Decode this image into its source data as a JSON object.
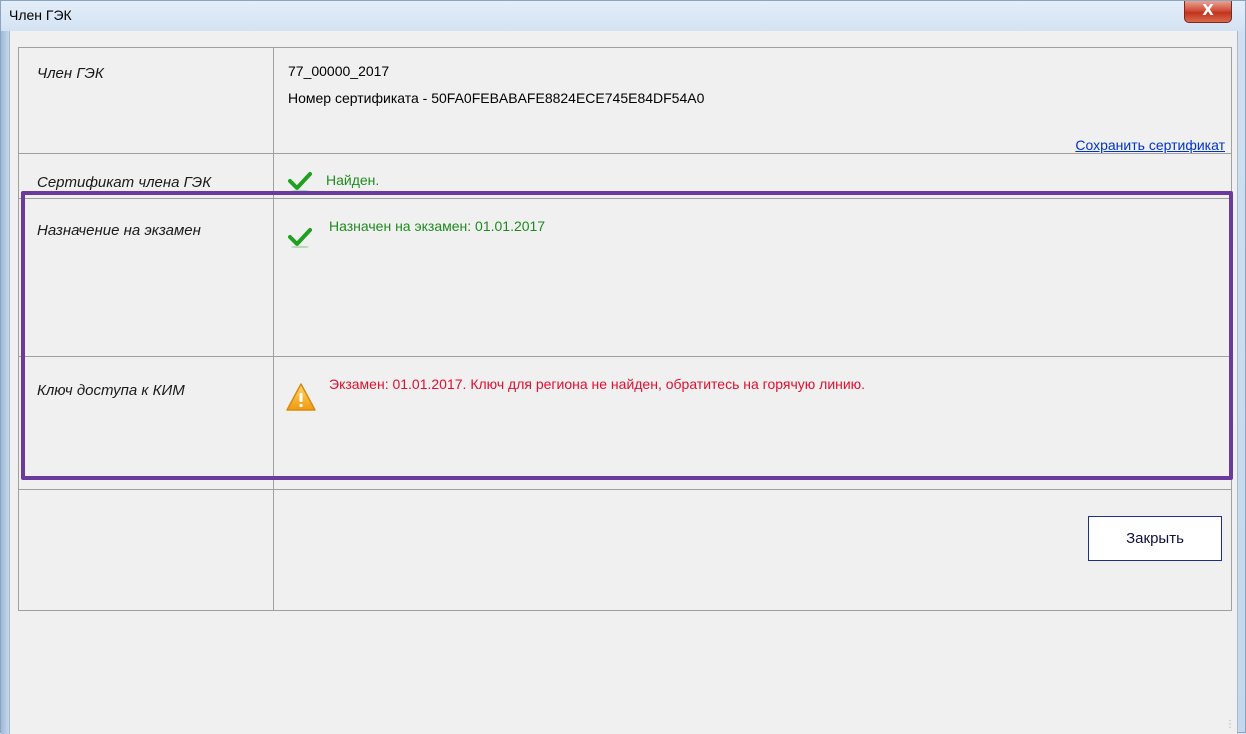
{
  "window": {
    "title": "Член ГЭК",
    "close_glyph": "X"
  },
  "rows": {
    "member": {
      "label": "Член ГЭК",
      "value_line1": "77_00000_2017",
      "value_line2": "Номер сертификата - 50FA0FEBABAFE8824ECE745E84DF54A0",
      "save_link": "Сохранить сертификат"
    },
    "certificate": {
      "label": "Сертификат члена ГЭК",
      "status_icon": "checkmark-icon",
      "status_text": "Найден."
    },
    "assignment": {
      "label": "Назначение на экзамен",
      "status_icon": "checkmark-icon",
      "status_text": "Назначен на экзамен: 01.01.2017"
    },
    "kim_key": {
      "label": "Ключ доступа к КИМ",
      "status_icon": "warning-icon",
      "status_text": "Экзамен: 01.01.2017. Ключ для региона не найден, обратитесь на горячую линию."
    }
  },
  "footer": {
    "close_button": "Закрыть"
  },
  "colors": {
    "ok": "#1f8a1f",
    "warning": "#e01030",
    "link": "#0033cc",
    "highlight_border": "#6b3aa0"
  }
}
